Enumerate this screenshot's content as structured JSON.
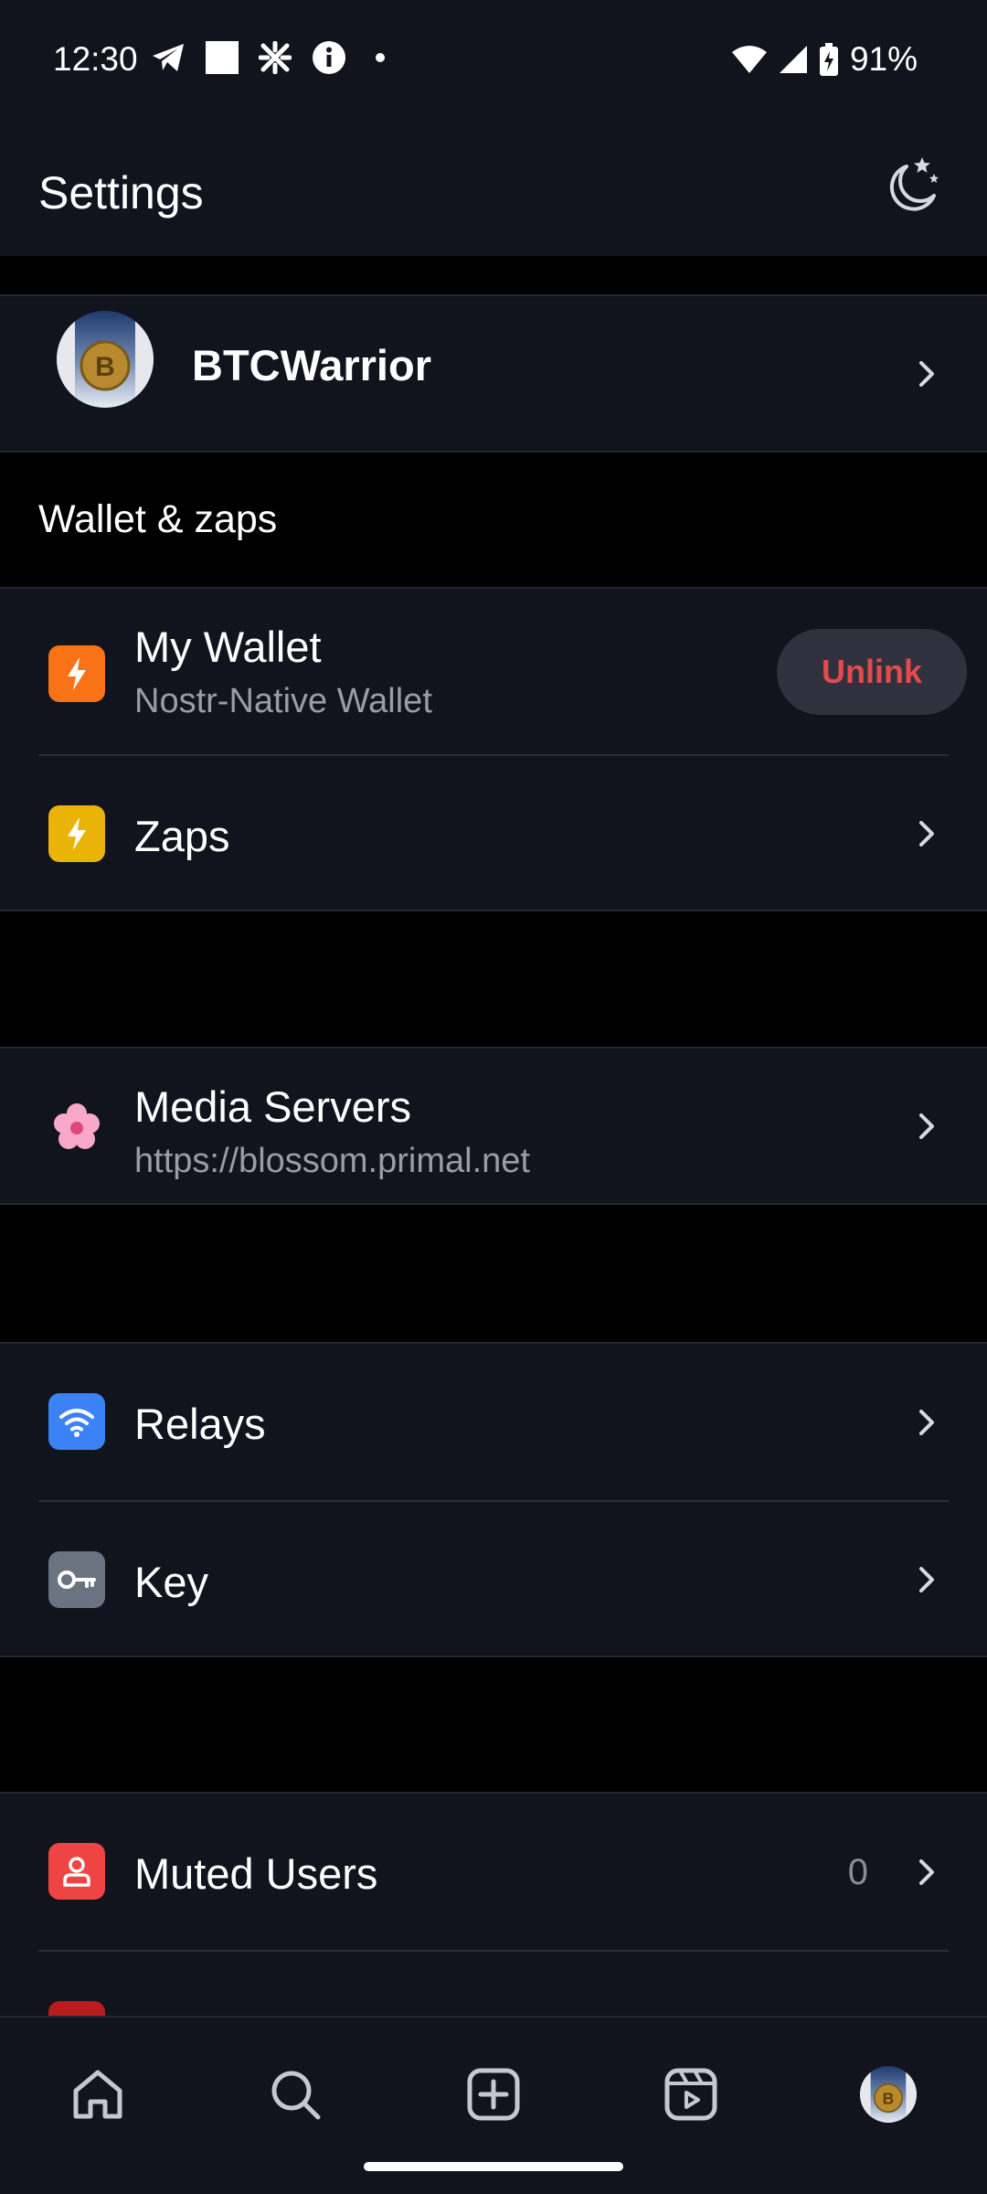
{
  "status": {
    "time": "12:30",
    "battery": "91%",
    "icons_left": [
      "telegram-icon",
      "stop-square-icon",
      "pinwheel-icon",
      "info-icon",
      "dot-icon"
    ],
    "icons_right": [
      "wifi-icon",
      "signal-icon",
      "battery-charging-icon"
    ]
  },
  "header": {
    "title": "Settings",
    "theme_icon": "moon-stars-icon"
  },
  "profile": {
    "name": "BTCWarrior"
  },
  "wallet_section": {
    "label": "Wallet & zaps",
    "my_wallet": {
      "title": "My Wallet",
      "subtitle": "Nostr-Native Wallet",
      "button": "Unlink",
      "icon": "bolt-icon"
    },
    "zaps": {
      "title": "Zaps",
      "icon": "bolt-icon"
    }
  },
  "media": {
    "title": "Media Servers",
    "subtitle": "https://blossom.primal.net",
    "icon": "blossom-icon"
  },
  "network": {
    "relays": {
      "title": "Relays",
      "icon": "wifi-icon"
    },
    "key": {
      "title": "Key",
      "icon": "key-icon"
    }
  },
  "moderation": {
    "muted": {
      "title": "Muted Users",
      "count": "0",
      "icon": "user-icon"
    }
  },
  "nav": [
    "home-icon",
    "search-icon",
    "add-post-icon",
    "reels-icon",
    "profile-avatar"
  ],
  "colors": {
    "background": "#000000",
    "surface": "#11141c",
    "wallet_orange": "#f97316",
    "zaps_yellow": "#eab308",
    "relays_blue": "#3b82f6",
    "key_gray": "#6b7280",
    "muted_red": "#ef4444",
    "unlink_red": "#e5484d"
  }
}
